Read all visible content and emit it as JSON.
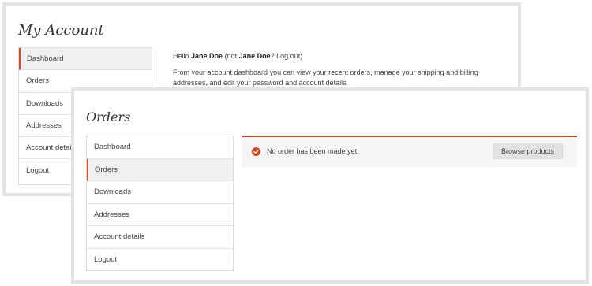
{
  "back": {
    "title": "My Account",
    "nav": [
      "Dashboard",
      "Orders",
      "Downloads",
      "Addresses",
      "Account details",
      "Logout"
    ],
    "active_index": 0,
    "greeting": {
      "hello": "Hello",
      "name": "Jane Doe",
      "not": "(not",
      "name2": "Jane Doe",
      "qmark": "?",
      "logout": "Log out",
      "close": ")"
    },
    "body": "From your account dashboard you can view your recent orders, manage your shipping and billing addresses, and edit your password and account details."
  },
  "front": {
    "title": "Orders",
    "nav": [
      "Dashboard",
      "Orders",
      "Downloads",
      "Addresses",
      "Account details",
      "Logout"
    ],
    "active_index": 1,
    "notice": "No order has been made yet.",
    "button": "Browse products"
  },
  "colors": {
    "accent": "#d9481c",
    "frame": "#e4e4e4",
    "active_bg": "#f0f0f0"
  }
}
